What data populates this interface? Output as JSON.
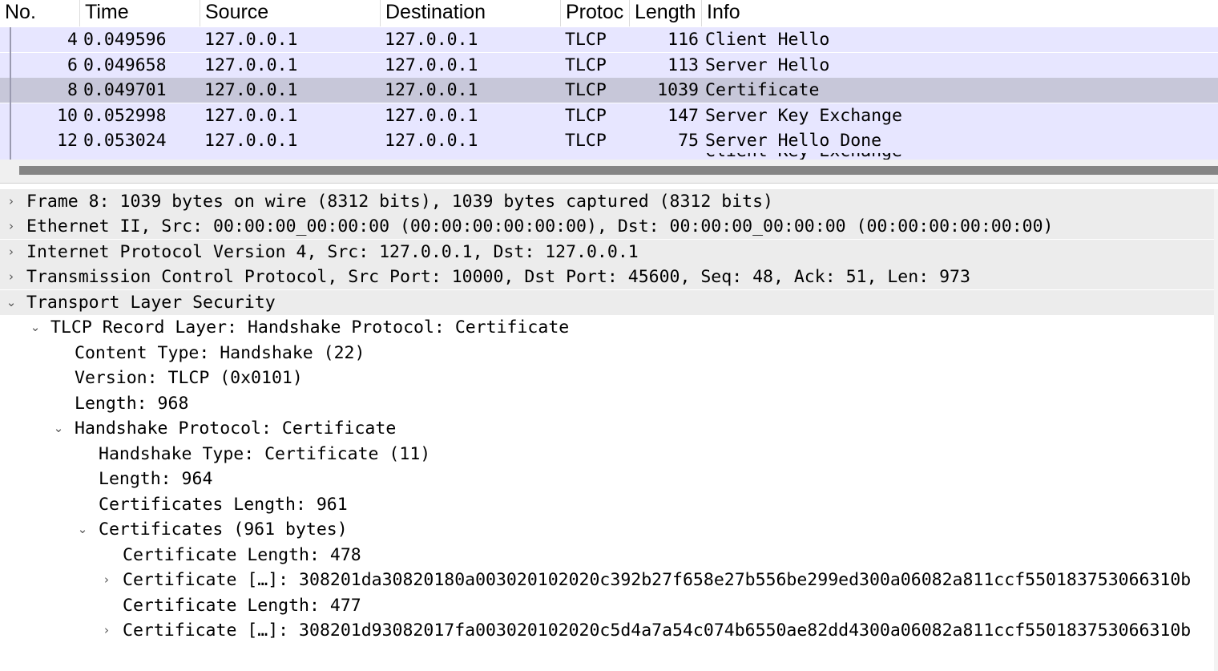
{
  "columns": {
    "no": "No.",
    "time": "Time",
    "source": "Source",
    "destination": "Destination",
    "protocol": "Protoc",
    "length": "Length",
    "info": "Info"
  },
  "packets": [
    {
      "no": "4",
      "time": "0.049596",
      "source": "127.0.0.1",
      "destination": "127.0.0.1",
      "protocol": "TLCP",
      "length": "116",
      "info": "Client Hello"
    },
    {
      "no": "6",
      "time": "0.049658",
      "source": "127.0.0.1",
      "destination": "127.0.0.1",
      "protocol": "TLCP",
      "length": "113",
      "info": "Server Hello"
    },
    {
      "no": "8",
      "time": "0.049701",
      "source": "127.0.0.1",
      "destination": "127.0.0.1",
      "protocol": "TLCP",
      "length": "1039",
      "info": "Certificate"
    },
    {
      "no": "10",
      "time": "0.052998",
      "source": "127.0.0.1",
      "destination": "127.0.0.1",
      "protocol": "TLCP",
      "length": "147",
      "info": "Server Key Exchange"
    },
    {
      "no": "12",
      "time": "0.053024",
      "source": "127.0.0.1",
      "destination": "127.0.0.1",
      "protocol": "TLCP",
      "length": "75",
      "info": "Server Hello Done"
    },
    {
      "no": "",
      "time": "",
      "source": "",
      "destination": "",
      "protocol": "",
      "length": "",
      "info": "Client Key Exchange"
    }
  ],
  "selected_packet_index": 2,
  "details": [
    {
      "text": "Frame 8: 1039 bytes on wire (8312 bits), 1039 bytes captured (8312 bits)",
      "arrow": "›"
    },
    {
      "text": "Ethernet II, Src: 00:00:00_00:00:00 (00:00:00:00:00:00), Dst: 00:00:00_00:00:00 (00:00:00:00:00:00)",
      "arrow": "›"
    },
    {
      "text": "Internet Protocol Version 4, Src: 127.0.0.1, Dst: 127.0.0.1",
      "arrow": "›"
    },
    {
      "text": "Transmission Control Protocol, Src Port: 10000, Dst Port: 45600, Seq: 48, Ack: 51, Len: 973",
      "arrow": "›"
    },
    {
      "text": "Transport Layer Security",
      "arrow": "⌄"
    },
    {
      "text": "TLCP Record Layer: Handshake Protocol: Certificate",
      "arrow": "⌄"
    },
    {
      "text": "Content Type: Handshake (22)",
      "arrow": ""
    },
    {
      "text": "Version: TLCP (0x0101)",
      "arrow": ""
    },
    {
      "text": "Length: 968",
      "arrow": ""
    },
    {
      "text": "Handshake Protocol: Certificate",
      "arrow": "⌄"
    },
    {
      "text": "Handshake Type: Certificate (11)",
      "arrow": ""
    },
    {
      "text": "Length: 964",
      "arrow": ""
    },
    {
      "text": "Certificates Length: 961",
      "arrow": ""
    },
    {
      "text": "Certificates (961 bytes)",
      "arrow": "⌄"
    },
    {
      "text": "Certificate Length: 478",
      "arrow": ""
    },
    {
      "text": "Certificate […]: 308201da30820180a003020102020c392b27f658e27b556be299ed300a06082a811ccf550183753066310b",
      "arrow": "›"
    },
    {
      "text": "Certificate Length: 477",
      "arrow": ""
    },
    {
      "text": "Certificate […]: 308201d93082017fa003020102020c5d4a7a54c074b6550ae82dd4300a06082a811ccf550183753066310b",
      "arrow": "›"
    }
  ]
}
